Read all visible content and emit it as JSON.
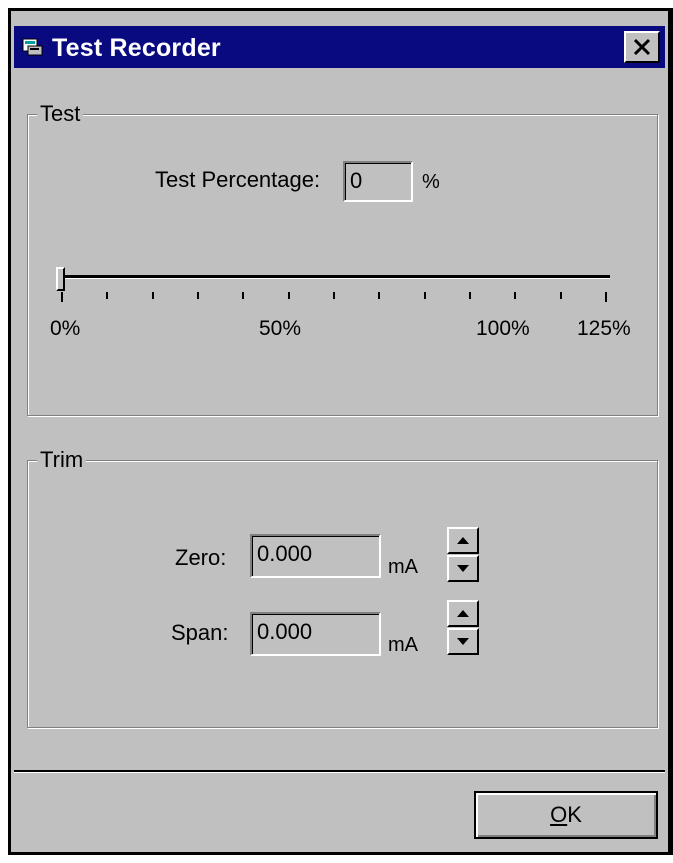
{
  "window": {
    "title": "Test Recorder",
    "close_label": "✕"
  },
  "test_group": {
    "label": "Test",
    "percentage_label": "Test Percentage:",
    "percentage_value": "0",
    "percentage_unit": "%",
    "slider": {
      "value_percent": 0,
      "min": 0,
      "max": 125,
      "tick_labels": [
        "0%",
        "50%",
        "100%",
        "125%"
      ]
    }
  },
  "trim_group": {
    "label": "Trim",
    "zero_label": "Zero:",
    "zero_value": "0.000",
    "zero_unit": "mA",
    "span_label": "Span:",
    "span_value": "0.000",
    "span_unit": "mA"
  },
  "buttons": {
    "ok_mnemonic": "O",
    "ok_rest": "K"
  }
}
